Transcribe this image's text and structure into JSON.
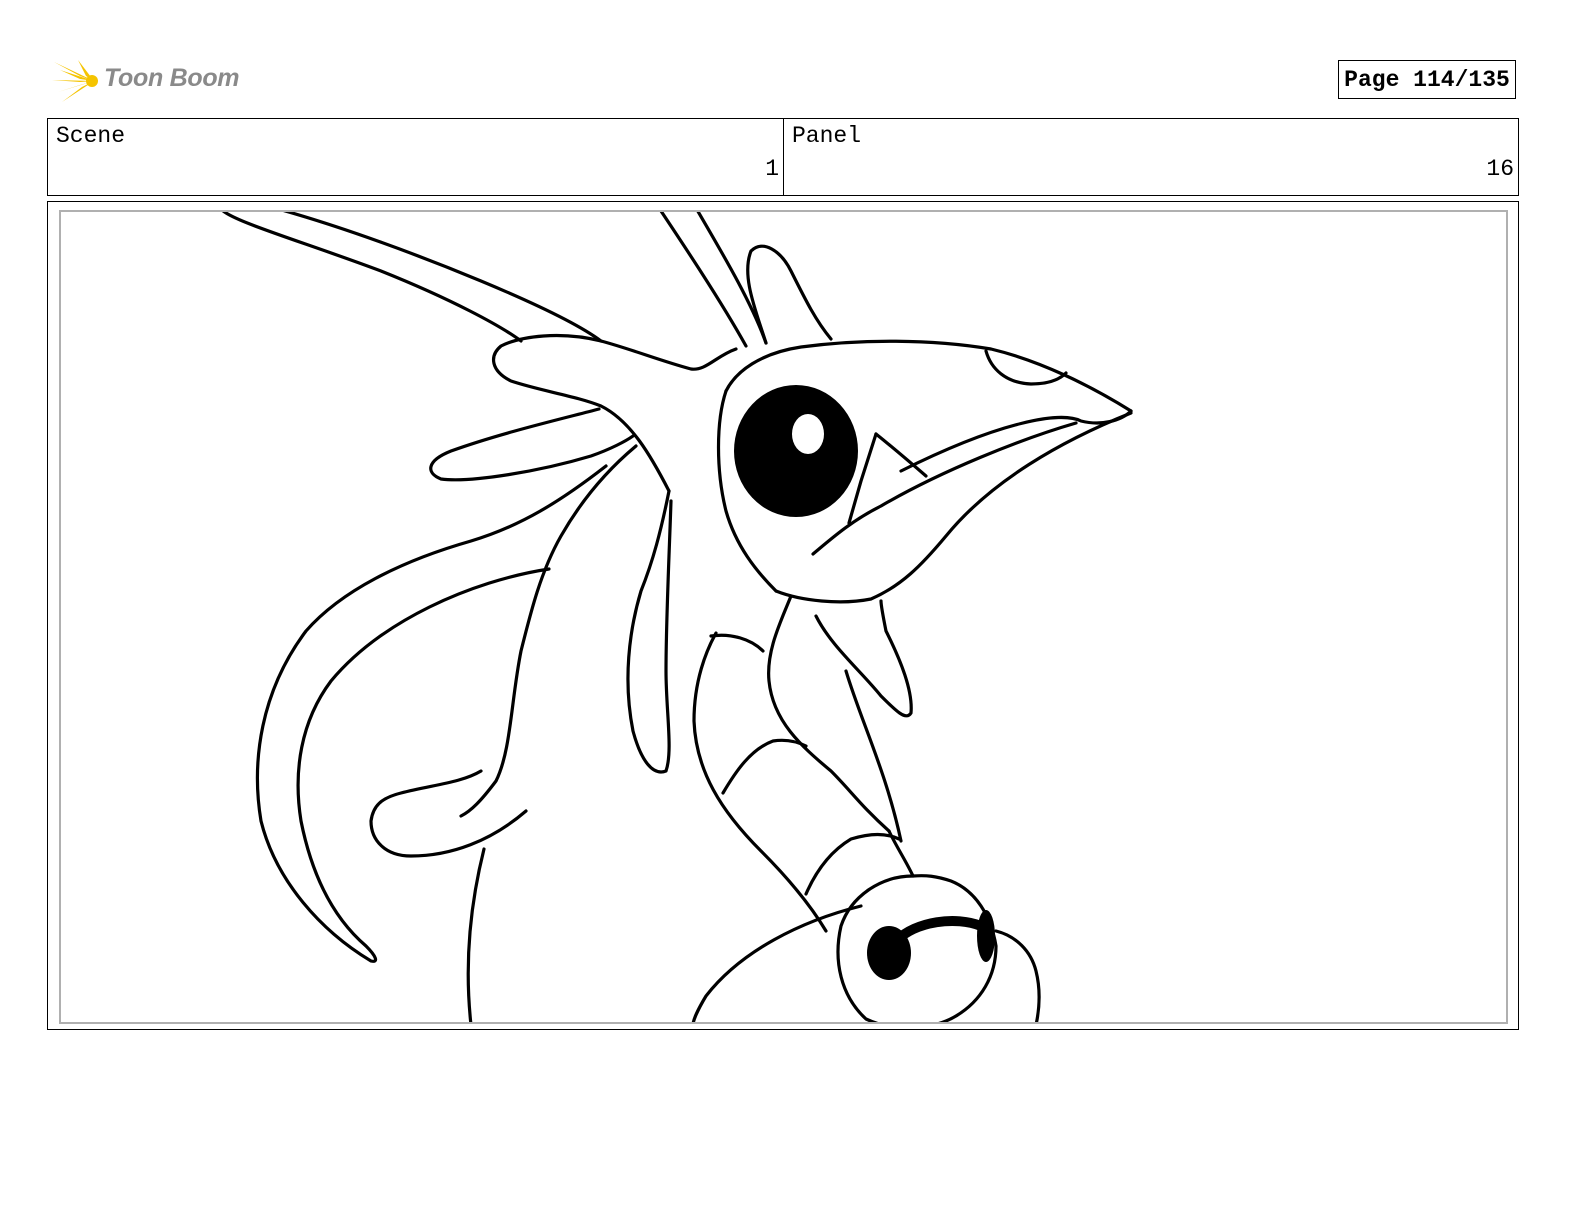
{
  "header": {
    "logo_text": "Toon Boom",
    "page_label": "Page 114/135"
  },
  "info": {
    "scene_label": "Scene",
    "scene_value": "1",
    "panel_label": "Panel",
    "panel_value": "16"
  },
  "colors": {
    "logo_burst": "#f5c400",
    "logo_text": "#8a8a8a",
    "frame_border": "#b0b0b0"
  }
}
